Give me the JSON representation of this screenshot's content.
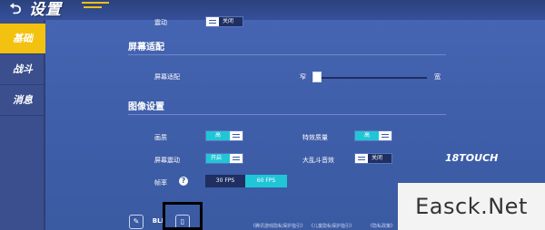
{
  "header": {
    "back_icon": "back-arrow-icon",
    "title": "设置"
  },
  "sidebar": {
    "items": [
      {
        "label": "基础",
        "active": true
      },
      {
        "label": "战斗",
        "active": false
      },
      {
        "label": "消息",
        "active": false
      }
    ]
  },
  "top_row": {
    "label": "震动",
    "toggle_text": "关闭"
  },
  "screen_adapt": {
    "section_title": "屏幕适配",
    "row_label": "屏幕适配",
    "min_label": "窄",
    "max_label": "宽",
    "slider_value": 0.0
  },
  "image_settings": {
    "section_title": "图像设置",
    "quality": {
      "label": "画质",
      "value": "高"
    },
    "effects": {
      "label": "特效质量",
      "value": "高"
    },
    "screen_shake": {
      "label": "屏幕震动",
      "value": "开启"
    },
    "big_fight": {
      "label": "大乱斗音效",
      "value": "关闭"
    },
    "fps": {
      "label": "帧率",
      "options": [
        "30 FPS",
        "60 FPS"
      ],
      "selected": "60 FPS"
    }
  },
  "bottom": {
    "icon_1": "edit-icon",
    "icon_2_text": "BLI",
    "icon_3": "phone-icon",
    "links": [
      "《腾讯游戏隐私保护指引》",
      "《儿童隐私保护指引》",
      "《隐私政策》"
    ]
  },
  "watermark": {
    "text": "Easck.Net",
    "logo": "18TOUCH"
  },
  "colors": {
    "accent": "#f3c10f",
    "toggle_on": "#21c6d6",
    "bg": "#3f5ea9"
  }
}
